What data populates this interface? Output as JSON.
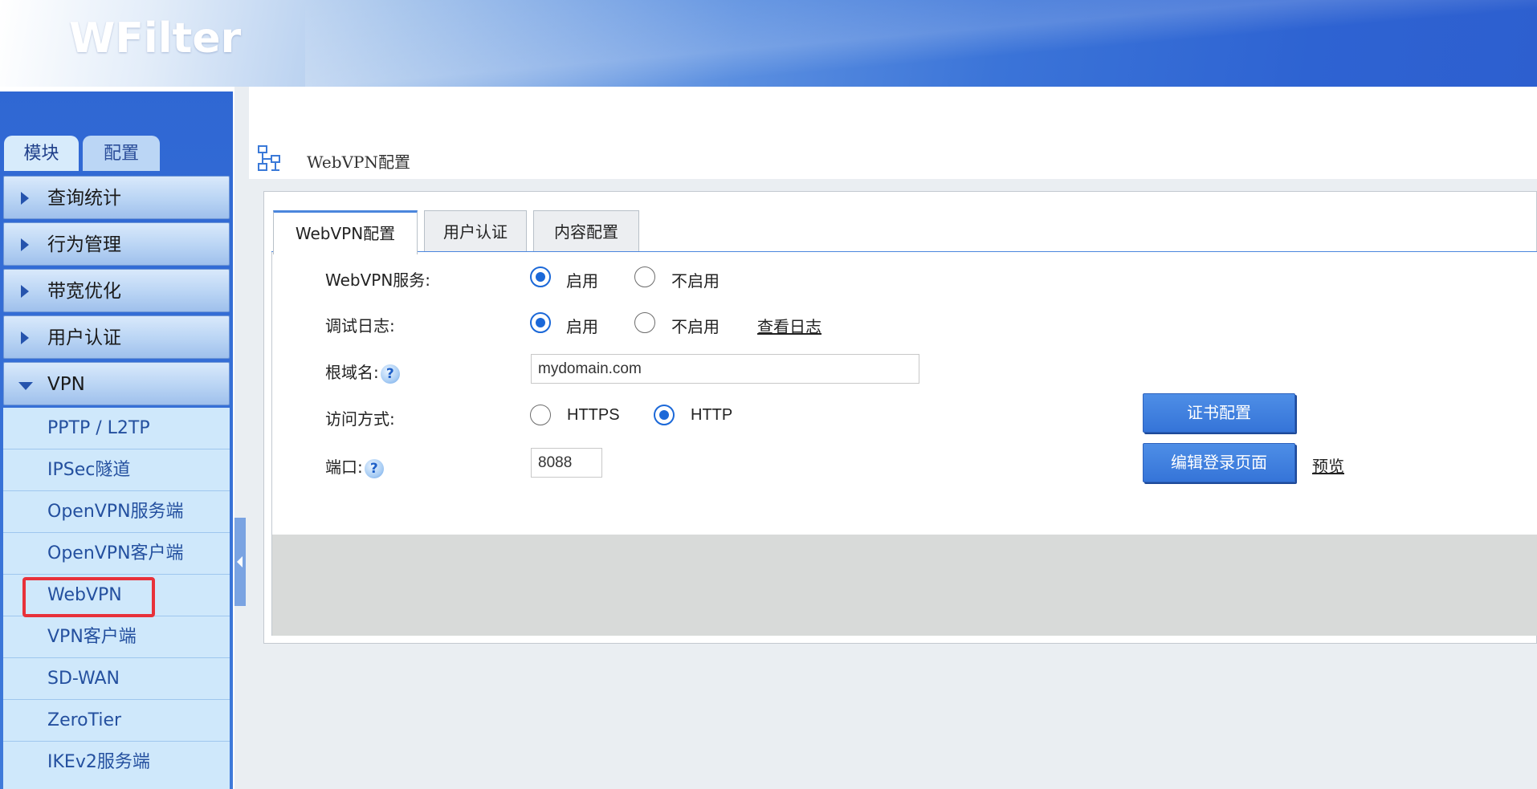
{
  "app": {
    "logo": "WFilter"
  },
  "sidebar": {
    "tabs": {
      "modules": "模块",
      "config": "配置"
    },
    "groups": [
      {
        "label": "查询统计"
      },
      {
        "label": "行为管理"
      },
      {
        "label": "带宽优化"
      },
      {
        "label": "用户认证"
      },
      {
        "label": "VPN"
      }
    ],
    "vpn_items": [
      {
        "label": "PPTP / L2TP"
      },
      {
        "label": "IPSec隧道"
      },
      {
        "label": "OpenVPN服务端"
      },
      {
        "label": "OpenVPN客户端"
      },
      {
        "label": "WebVPN"
      },
      {
        "label": "VPN客户端"
      },
      {
        "label": "SD-WAN"
      },
      {
        "label": "ZeroTier"
      },
      {
        "label": "IKEv2服务端"
      }
    ]
  },
  "breadcrumb": {
    "title": "WebVPN配置"
  },
  "tabs": {
    "webvpn": "WebVPN配置",
    "userauth": "用户认证",
    "content": "内容配置"
  },
  "form": {
    "service": {
      "label": "WebVPN服务:",
      "on": "启用",
      "off": "不启用",
      "selected": "on"
    },
    "debug": {
      "label": "调试日志:",
      "on": "启用",
      "off": "不启用",
      "selected": "on",
      "view_log": "查看日志"
    },
    "domain": {
      "label": "根域名:",
      "value": "mydomain.com"
    },
    "access": {
      "label": "访问方式:",
      "https": "HTTPS",
      "http": "HTTP",
      "selected": "http"
    },
    "port": {
      "label": "端口:",
      "value": "8088"
    },
    "help_glyph": "?",
    "cert_button": "证书配置",
    "edit_login_button": "编辑登录页面",
    "preview": "预览"
  },
  "colors": {
    "accent": "#1b68d8",
    "highlight": "#e8313a",
    "button": "#3f7fdf"
  }
}
